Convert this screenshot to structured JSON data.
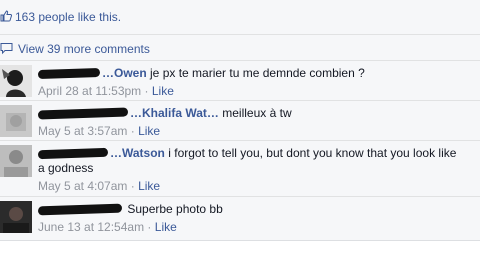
{
  "likes": {
    "text": "163 people like this."
  },
  "view_more": {
    "text": "View 39 more comments"
  },
  "comments": [
    {
      "author": "…Owen",
      "text": "je px te marier tu me demnde combien ?",
      "time": "April 28 at 11:53pm",
      "like": "Like"
    },
    {
      "author": "…Khalifa Wat…",
      "text": "meilleux à tw",
      "time": "May 5 at 3:57am",
      "like": "Like"
    },
    {
      "author": "…Watson",
      "text": "i forgot to tell you, but dont you know that you look like a godness",
      "time": "May 5 at 4:07am",
      "like": "Like"
    },
    {
      "author": "",
      "text": "Superbe photo bb",
      "time": "June 13 at 12:54am",
      "like": "Like"
    }
  ],
  "separator": "·",
  "colors": {
    "link": "#3b5998",
    "meta": "#90949c",
    "panel": "#f6f7f9"
  },
  "icons": {
    "like": "thumbs-up-icon",
    "comment": "comment-bubble-icon"
  }
}
